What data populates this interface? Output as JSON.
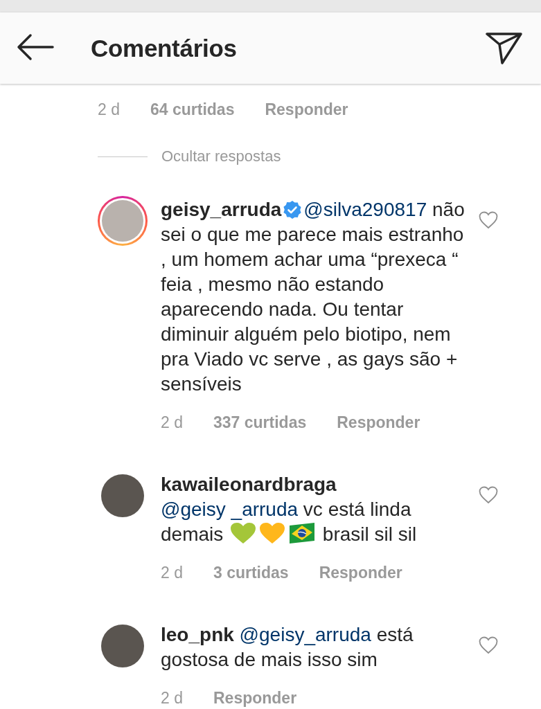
{
  "header": {
    "title": "Comentários"
  },
  "previous_comment": {
    "time": "2 d",
    "likes": "64 curtidas",
    "reply": "Responder"
  },
  "hide_replies": "Ocultar respostas",
  "replies": [
    {
      "username": "geisy_arruda",
      "verified": true,
      "story_ring": true,
      "liked": false,
      "body": [
        {
          "kind": "mention",
          "text": "@silva290817"
        },
        {
          "kind": "text",
          "text": "não sei o que me parece mais estranho , um homem achar uma “prexeca “ feia , mesmo não estando aparecendo nada. Ou tentar diminuir alguém pelo biotipo, nem pra Viado vc serve , as gays são + sensíveis"
        }
      ],
      "time": "2 d",
      "likes": "337 curtidas",
      "reply": "Responder"
    },
    {
      "username": "kawaileonardbraga",
      "verified": false,
      "story_ring": false,
      "liked": false,
      "body": [
        {
          "kind": "mention",
          "text": "@geisy _arruda"
        },
        {
          "kind": "text",
          "text": "vc está linda demais"
        },
        {
          "kind": "heart",
          "color": "#a4c639"
        },
        {
          "kind": "heart",
          "color": "#ffb71b"
        },
        {
          "kind": "flag"
        },
        {
          "kind": "text",
          "text": "brasil sil sil"
        }
      ],
      "time": "2 d",
      "likes": "3 curtidas",
      "reply": "Responder"
    },
    {
      "username": "leo_pnk",
      "verified": false,
      "story_ring": false,
      "liked": false,
      "body": [
        {
          "kind": "mention",
          "text": "@geisy_arruda"
        },
        {
          "kind": "text",
          "text": "está gostosa de mais isso sim"
        }
      ],
      "time": "2 d",
      "reply": "Responder"
    }
  ]
}
